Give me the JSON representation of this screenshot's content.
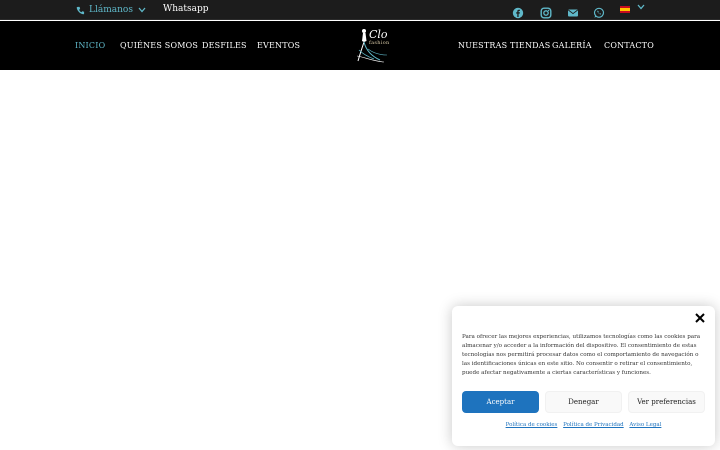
{
  "topbar": {
    "call_label": "Llámanos",
    "whatsapp_label": "Whatsapp",
    "socials": [
      "facebook-icon",
      "instagram-icon",
      "email-icon",
      "whatsapp-icon"
    ],
    "language_flag": "spain-flag-icon"
  },
  "nav": {
    "items_left": [
      "INICIO",
      "QUIÉNES SOMOS",
      "DESFILES",
      "EVENTOS"
    ],
    "items_right": [
      "NUESTRAS TIENDAS",
      "GALERÍA",
      "CONTACTO"
    ],
    "active": "INICIO",
    "logo": {
      "title": "Clo",
      "subtitle": "fashion"
    }
  },
  "cookie_banner": {
    "text": "Para ofrecer las mejores experiencias, utilizamos tecnologías como las cookies para almacenar y/o acceder a la información del dispositivo. El consentimiento de estas tecnologías nos permitirá procesar datos como el comportamiento de navegación o las identificaciones únicas en este sitio. No consentir o retirar el consentimiento, puede afectar negativamente a ciertas características y funciones.",
    "accept": "Aceptar",
    "deny": "Denegar",
    "preferences": "Ver preferencias",
    "links": [
      "Política de cookies",
      "Política de Privacidad",
      "Aviso Legal"
    ]
  },
  "colors": {
    "accent": "#5fb8c9",
    "button_blue": "#1e73be",
    "nav_bg": "#000000",
    "topbar_bg": "#1c1c1c"
  }
}
